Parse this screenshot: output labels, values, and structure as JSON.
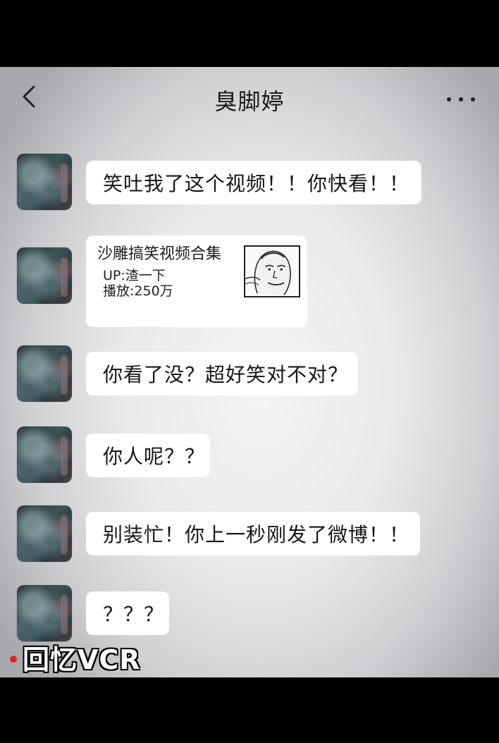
{
  "header": {
    "back_icon": "chevron-left-icon",
    "title": "臭脚婷",
    "more_icon": "more-dots-icon"
  },
  "messages": [
    {
      "type": "text",
      "text": "笑吐我了这个视频！！你快看！！"
    },
    {
      "type": "video_card",
      "title": "沙雕搞笑视频合集",
      "uploader": "UP:渣一下",
      "plays": "播放:250万",
      "thumbnail_icon": "meme-face-thumbnail"
    },
    {
      "type": "text",
      "text": "你看了没？超好笑对不对？"
    },
    {
      "type": "text",
      "text": "你人呢？？"
    },
    {
      "type": "text",
      "text": "别装忙！你上一秒刚发了微博！！"
    },
    {
      "type": "text",
      "text": "？？？"
    }
  ],
  "overlay": {
    "label": "回忆VCR",
    "record_dot_color": "#d8262a"
  }
}
